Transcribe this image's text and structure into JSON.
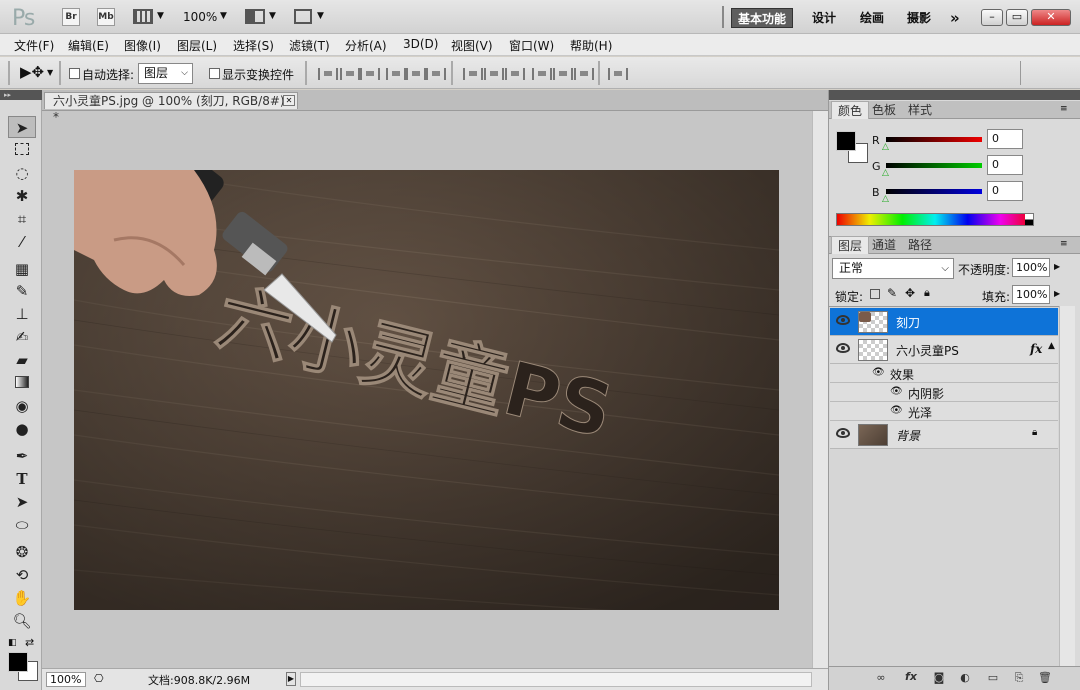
{
  "titlebar": {
    "logo": "Ps",
    "br_label": "Br",
    "mb_label": "Mb",
    "zoom": "100%",
    "workspaces": [
      "基本功能",
      "设计",
      "绘画",
      "摄影"
    ],
    "more": "»"
  },
  "menu": [
    "文件(F)",
    "编辑(E)",
    "图像(I)",
    "图层(L)",
    "选择(S)",
    "滤镜(T)",
    "分析(A)",
    "3D(D)",
    "视图(V)",
    "窗口(W)",
    "帮助(H)"
  ],
  "options": {
    "auto_select_label": "自动选择:",
    "auto_select_value": "图层",
    "show_transform_label": "显示变换控件"
  },
  "document": {
    "tab_title": "六小灵童PS.jpg @ 100% (刻刀, RGB/8#) *",
    "canvas_text": "六小灵童PS"
  },
  "status": {
    "zoom": "100%",
    "doc_info": "文档:908.8K/2.96M"
  },
  "color_panel": {
    "tabs": [
      "颜色",
      "色板",
      "样式"
    ],
    "channels": [
      {
        "label": "R",
        "value": "0",
        "color": "#cc0000"
      },
      {
        "label": "G",
        "value": "0",
        "color": "#00aa00"
      },
      {
        "label": "B",
        "value": "0",
        "color": "#0000cc"
      }
    ]
  },
  "layers_panel": {
    "tabs": [
      "图层",
      "通道",
      "路径"
    ],
    "blend_mode": "正常",
    "opacity_label": "不透明度:",
    "opacity_value": "100%",
    "lock_label": "锁定:",
    "fill_label": "填充:",
    "fill_value": "100%",
    "layers": [
      {
        "name": "刻刀",
        "selected": true
      },
      {
        "name": "六小灵童PS",
        "fx": "fx"
      },
      {
        "name": "背景",
        "locked": true
      }
    ],
    "effects_label": "效果",
    "effects": [
      "内阴影",
      "光泽"
    ]
  }
}
